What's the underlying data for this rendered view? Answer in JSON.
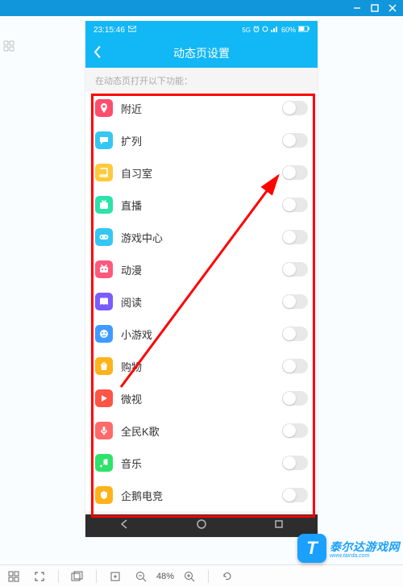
{
  "window": {
    "controls": [
      "minimize",
      "maximize",
      "close"
    ]
  },
  "phone": {
    "status": {
      "time": "23:15:46",
      "battery": "60%",
      "alarm": true,
      "signal": true
    },
    "header": {
      "title": "动态页设置"
    },
    "subhead": "在动态页打开以下功能：",
    "items": [
      {
        "label": "附近",
        "icon": "pin",
        "color": "#ff4d6d"
      },
      {
        "label": "扩列",
        "icon": "chat",
        "color": "#35c7f4"
      },
      {
        "label": "自习室",
        "icon": "book",
        "color": "#ffc93c"
      },
      {
        "label": "直播",
        "icon": "live",
        "color": "#2de3a8"
      },
      {
        "label": "游戏中心",
        "icon": "gamepad",
        "color": "#35c7f4"
      },
      {
        "label": "动漫",
        "icon": "anime",
        "color": "#ff5a7d"
      },
      {
        "label": "阅读",
        "icon": "read",
        "color": "#7a5cff"
      },
      {
        "label": "小游戏",
        "icon": "minigame",
        "color": "#3f9bff"
      },
      {
        "label": "购物",
        "icon": "shop",
        "color": "#ffb31a"
      },
      {
        "label": "微视",
        "icon": "play",
        "color": "#ff5544"
      },
      {
        "label": "全民K歌",
        "icon": "mic",
        "color": "#ff6b6b"
      },
      {
        "label": "音乐",
        "icon": "music",
        "color": "#2de36b"
      },
      {
        "label": "企鹅电竞",
        "icon": "esports",
        "color": "#ffb31a"
      }
    ]
  },
  "toolbar": {
    "zoom": "48%"
  },
  "watermark": {
    "initial": "T",
    "title": "泰尔达游戏网",
    "url": "www.tairda.com"
  }
}
